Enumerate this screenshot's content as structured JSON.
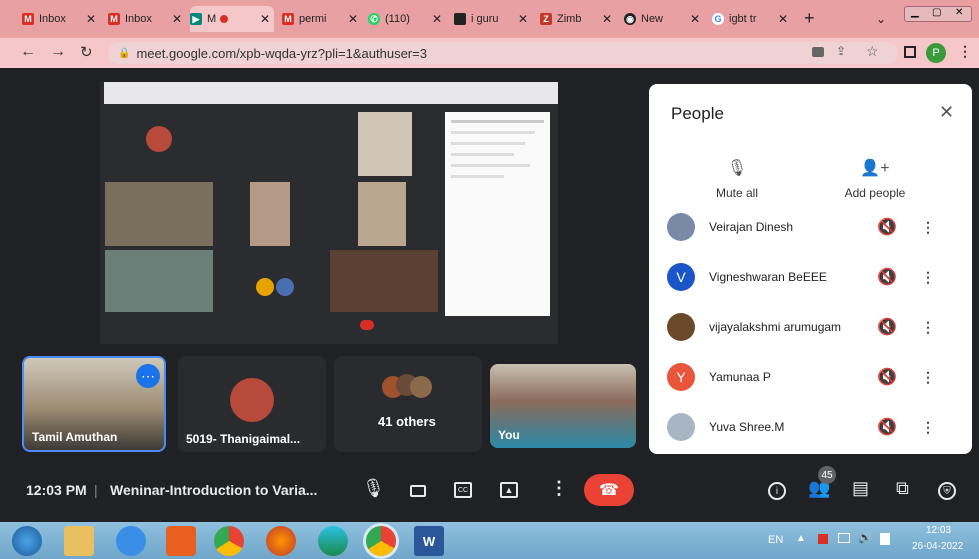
{
  "browser": {
    "tabs": [
      {
        "label": "Inbox",
        "icon": "gmail-icon",
        "color": "#d93025"
      },
      {
        "label": "Inbox",
        "icon": "gmail-icon",
        "color": "#d93025"
      },
      {
        "label": "M",
        "icon": "meet-icon",
        "color": "#00897b"
      },
      {
        "label": "permi",
        "icon": "gmail-icon",
        "color": "#d93025"
      },
      {
        "label": "(110)",
        "icon": "whatsapp-icon",
        "color": "#25d366"
      },
      {
        "label": "i guru",
        "icon": "page-icon",
        "color": "#222222"
      },
      {
        "label": "Zimb",
        "icon": "zimbra-icon",
        "color": "#c0392b"
      },
      {
        "label": "New",
        "icon": "github-icon",
        "color": "#222222"
      },
      {
        "label": "igbt tr",
        "icon": "google-icon",
        "color": "#4285f4"
      }
    ],
    "url": "meet.google.com/xpb-wqda-yrz?pli=1&authuser=3",
    "profile_initial": "P"
  },
  "tiles": [
    {
      "name": "Tamil Amuthan"
    },
    {
      "name": "5019- Thanigaimal..."
    },
    {
      "name": "41 others"
    },
    {
      "name": "You"
    }
  ],
  "people_panel": {
    "title": "People",
    "mute_all": "Mute all",
    "add_people": "Add people",
    "people": [
      {
        "name": "Veirajan Dinesh",
        "avatar": "",
        "color": "#7a8aa6"
      },
      {
        "name": "Vigneshwaran BeEEE",
        "avatar": "V",
        "color": "#1a56c9"
      },
      {
        "name": "vijayalakshmi arumugam",
        "avatar": "",
        "color": "#6a4a2a"
      },
      {
        "name": "Yamunaa P",
        "avatar": "Y",
        "color": "#e8553a"
      },
      {
        "name": "Yuva Shree.M",
        "avatar": "",
        "color": "#a8b6c4"
      }
    ]
  },
  "bottom_bar": {
    "time": "12:03 PM",
    "meeting_title": "Weninar-Introduction to Varia...",
    "participants_badge": "45"
  },
  "taskbar": {
    "lang": "EN",
    "clock_time": "12:03",
    "clock_date": "26-04-2022"
  }
}
